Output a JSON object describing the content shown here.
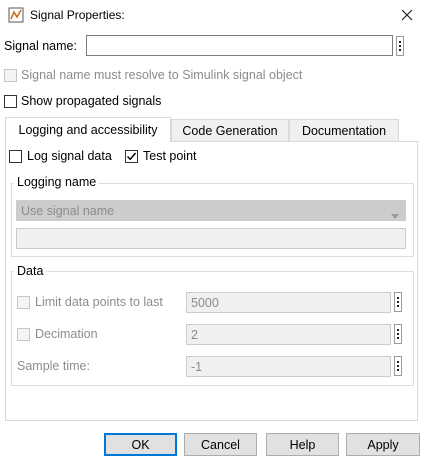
{
  "window": {
    "title": "Signal Properties:",
    "icon": "simulink-app-icon",
    "close_icon": "close-icon"
  },
  "signal_name": {
    "label": "Signal name:",
    "value": ""
  },
  "resolve_checkbox": {
    "label": "Signal name must resolve to Simulink signal object",
    "checked": false,
    "enabled": false
  },
  "propagated_checkbox": {
    "label": "Show propagated signals",
    "checked": false
  },
  "tabs": [
    {
      "label": "Logging and accessibility",
      "active": true
    },
    {
      "label": "Code Generation",
      "active": false
    },
    {
      "label": "Documentation",
      "active": false
    }
  ],
  "logging": {
    "log_signal_data": {
      "label": "Log signal data",
      "checked": false
    },
    "test_point": {
      "label": "Test point",
      "checked": true
    },
    "logging_name": {
      "legend": "Logging name",
      "selected": "Use signal name",
      "custom_value": ""
    },
    "data": {
      "legend": "Data",
      "limit": {
        "label": "Limit data points to last",
        "checked": false,
        "value": "5000"
      },
      "decimation": {
        "label": "Decimation",
        "checked": false,
        "value": "2"
      },
      "sample_time": {
        "label": "Sample time:",
        "value": "-1"
      }
    }
  },
  "buttons": {
    "ok": "OK",
    "cancel": "Cancel",
    "help": "Help",
    "apply": "Apply"
  }
}
